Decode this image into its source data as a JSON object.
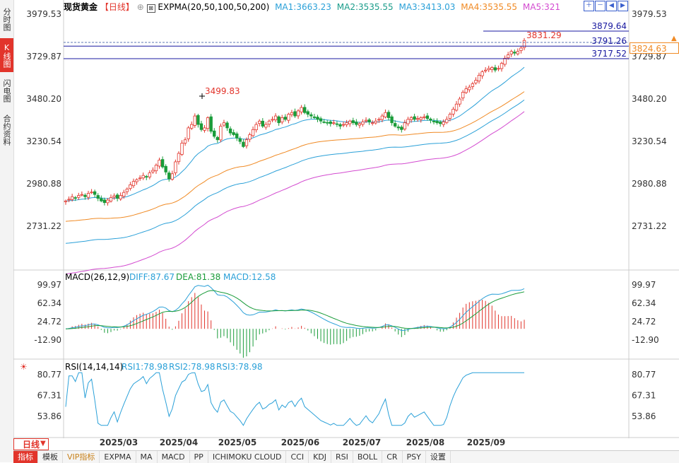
{
  "sidebar": {
    "tabs": [
      {
        "label": "分时图",
        "active": false
      },
      {
        "label": "K线图",
        "active": true
      },
      {
        "label": "闪电图",
        "active": false
      },
      {
        "label": "合约资料",
        "active": false
      }
    ]
  },
  "header": {
    "symbol": "现货黄金",
    "period": "【日线】",
    "add_symbol": "⊕",
    "indicator": "EXPMA(20,50,100,50,200)",
    "ma1": "MA1:3663.23",
    "ma2": "MA2:3535.55",
    "ma3": "MA3:3413.03",
    "ma4": "MA4:3535.55",
    "ma5": "MA5:321"
  },
  "toolbar_icons": [
    "plus-icon",
    "minus-icon",
    "left-icon",
    "right-icon"
  ],
  "price_axis": {
    "ticks": [
      "3979.53",
      "3729.87",
      "3480.20",
      "3230.54",
      "2980.88",
      "2731.22"
    ]
  },
  "annotations": {
    "high_label": "3499.83",
    "recent_high_label": "3831.29",
    "line_3879": "3879.64",
    "line_3791": "3791.26",
    "line_3717": "3717.52",
    "current_price": "3824.63"
  },
  "macd": {
    "title": "MACD(26,12,9)",
    "diff": "DIFF:87.67",
    "dea": "DEA:81.38",
    "macd": "MACD:12.58",
    "ticks": [
      "99.97",
      "62.34",
      "24.72",
      "-12.90"
    ]
  },
  "rsi": {
    "title": "RSI(14,14,14)",
    "rsi1": "RSI1:78.98",
    "rsi2": "RSI2:78.98",
    "rsi3": "RSI3:78.98",
    "ticks": [
      "80.77",
      "67.31",
      "53.86"
    ]
  },
  "time_axis": [
    "2025/03",
    "2025/04",
    "2025/05",
    "2025/06",
    "2025/07",
    "2025/08",
    "2025/09"
  ],
  "period_tab": "日线",
  "bottom_bar": [
    "指标",
    "模板",
    "VIP指标",
    "EXPMA",
    "MA",
    "MACD",
    "PP",
    "ICHIMOKU CLOUD",
    "CCI",
    "KDJ",
    "RSI",
    "BOLL",
    "CR",
    "PSY",
    "设置"
  ],
  "colors": {
    "up": "#e2342b",
    "down": "#1a9c3a",
    "ma1": "#2aa0d8",
    "ma2": "#1a9c8a",
    "ma3": "#2aa0d8",
    "ma4": "#f08a24",
    "ma5": "#d34bd0",
    "diff": "#2aa0d8",
    "dea": "#1a9c3a",
    "rsi": "#2aa0d8",
    "hline": "#1a1aa0",
    "current": "#f08a24"
  },
  "chart_data": {
    "type": "candlestick",
    "x_range": [
      "2025/02",
      "2025/09"
    ],
    "price_range": [
      2650,
      4000
    ],
    "closes": [
      2880,
      2890,
      2905,
      2898,
      2912,
      2918,
      2905,
      2925,
      2932,
      2918,
      2895,
      2880,
      2870,
      2885,
      2900,
      2910,
      2895,
      2912,
      2930,
      2950,
      2975,
      2995,
      3005,
      3015,
      3030,
      3020,
      3045,
      3060,
      3090,
      3120,
      3080,
      3050,
      3010,
      3040,
      3110,
      3160,
      3220,
      3240,
      3310,
      3330,
      3380,
      3330,
      3300,
      3310,
      3370,
      3290,
      3260,
      3240,
      3320,
      3340,
      3310,
      3280,
      3270,
      3250,
      3230,
      3200,
      3240,
      3270,
      3300,
      3330,
      3350,
      3320,
      3330,
      3350,
      3360,
      3380,
      3340,
      3370,
      3360,
      3390,
      3400,
      3380,
      3410,
      3430,
      3400,
      3390,
      3380,
      3370,
      3360,
      3350,
      3345,
      3340,
      3335,
      3340,
      3330,
      3320,
      3330,
      3340,
      3350,
      3340,
      3330,
      3335,
      3345,
      3355,
      3345,
      3340,
      3350,
      3360,
      3380,
      3400,
      3370,
      3340,
      3320,
      3310,
      3300,
      3340,
      3360,
      3370,
      3360,
      3365,
      3370,
      3375,
      3365,
      3355,
      3345,
      3340,
      3335,
      3345,
      3360,
      3390,
      3420,
      3450,
      3480,
      3520,
      3540,
      3550,
      3570,
      3590,
      3620,
      3640,
      3650,
      3660,
      3665,
      3650,
      3660,
      3690,
      3720,
      3740,
      3760,
      3750,
      3760,
      3780,
      3824.63
    ],
    "ma_last": {
      "MA1": 3663.23,
      "MA2": 3535.55,
      "MA3": 3413.03,
      "MA4": 3535.55
    },
    "horizontal_lines": [
      3879.64,
      3791.26,
      3717.52
    ]
  }
}
